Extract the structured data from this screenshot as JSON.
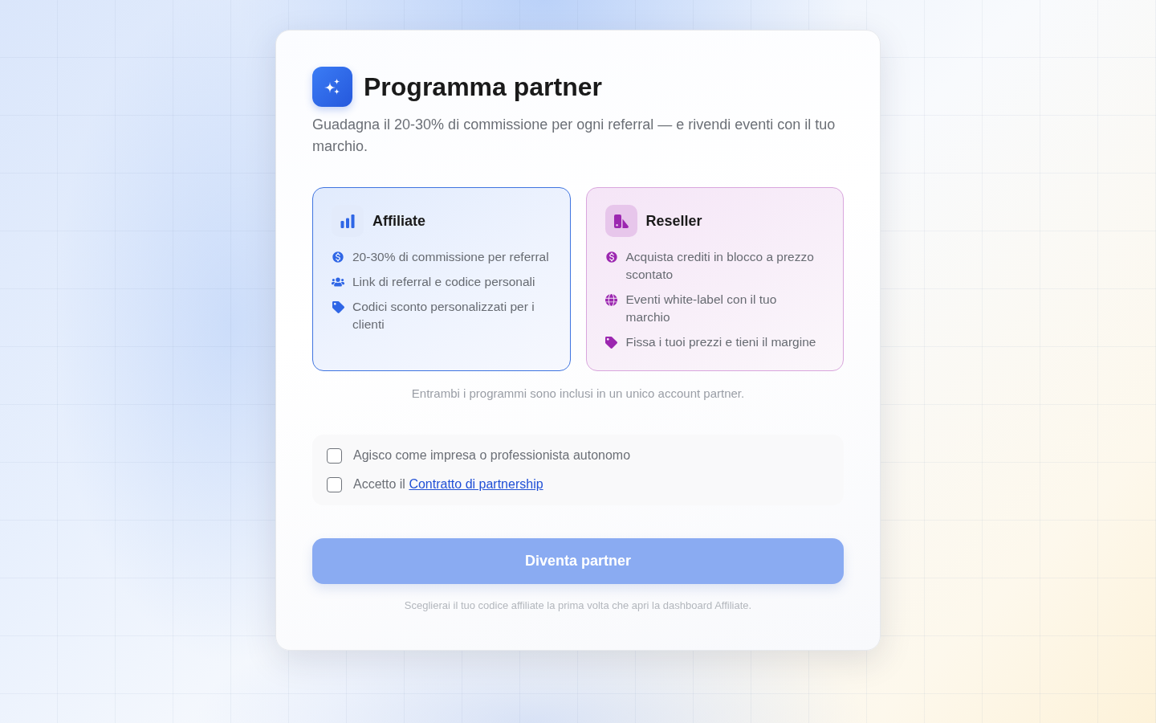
{
  "header": {
    "title": "Programma partner",
    "subtitle": "Guadagna il 20-30% di commissione per ogni referral — e rivendi eventi con il tuo marchio."
  },
  "programs": [
    {
      "kind": "affiliate",
      "title": "Affiliate",
      "features": [
        {
          "kind": "money",
          "text": "20-30% di commissione per referral"
        },
        {
          "kind": "people",
          "text": "Link di referral e codice personali"
        },
        {
          "kind": "tag",
          "text": "Codici sconto personalizzati per i clienti"
        }
      ]
    },
    {
      "kind": "reseller",
      "title": "Reseller",
      "features": [
        {
          "kind": "money",
          "text": "Acquista crediti in blocco a prezzo scontato"
        },
        {
          "kind": "globe",
          "text": "Eventi white-label con il tuo marchio"
        },
        {
          "kind": "tag",
          "text": "Fissa i tuoi prezzi e tieni il margine"
        }
      ]
    }
  ],
  "note": "Entrambi i programmi sono inclusi in un unico account partner.",
  "agreements": [
    {
      "label": "Agisco come impresa o professionista autonomo",
      "checked": false
    },
    {
      "label": "Accetto il",
      "link": "Contratto di partnership",
      "checked": false
    }
  ],
  "submit": {
    "label": "Diventa partner",
    "disabled": true
  },
  "hint": "Sceglierai il tuo codice affiliate la prima volta che apri la dashboard Affiliate."
}
